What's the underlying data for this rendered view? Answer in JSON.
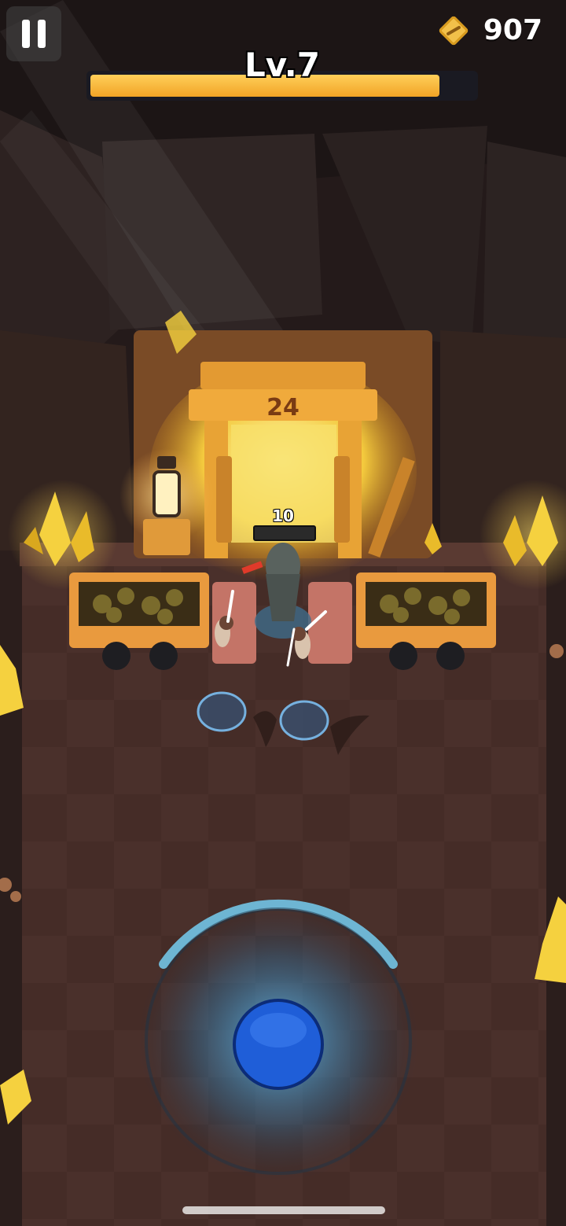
{
  "hud": {
    "gold_value": "907",
    "level_label": "Lv.7",
    "level_progress": 0.91
  },
  "scene": {
    "mine_number": "24",
    "player_hp_value": "10"
  },
  "icons": {
    "pause": "pause-icon",
    "gold": "gold-coin-icon"
  },
  "colors": {
    "level_bar": "#f3b02e",
    "joystick": "#1f5ed8",
    "gold": "#f2c04a"
  }
}
